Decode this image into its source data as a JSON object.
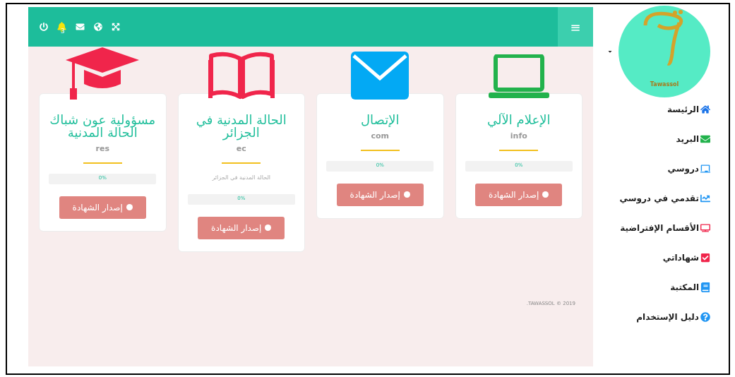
{
  "header": {
    "notifications": {
      "count": "3"
    },
    "menu_button": "≡"
  },
  "cards": [
    {
      "title": "الإعلام الآلي",
      "code": "info",
      "kind": "laptop",
      "progress": {
        "level": 0,
        "reading": "0%"
      },
      "button": "إصدار الشهادة"
    },
    {
      "title": "الإتصال",
      "code": "com",
      "kind": "envelope",
      "progress": {
        "level": 0,
        "reading": "0%"
      },
      "button": "إصدار الشهادة"
    },
    {
      "title": "الحالة المدنية في الجزائر",
      "code": "ec",
      "kind": "book",
      "description": "الحالة المدنية في الجزائر",
      "progress": {
        "level": 0,
        "reading": "0%"
      },
      "button": "إصدار الشهادة"
    },
    {
      "title": "مسؤولية عون شباك الحالة المدنية",
      "code": "res",
      "kind": "cap",
      "progress": {
        "level": 0,
        "reading": "0%"
      },
      "button": "إصدار الشهادة"
    }
  ],
  "footer": ".TAWASSOL © 2019",
  "sidebar": {
    "logo_text": "Tawassol",
    "items": [
      {
        "label": "الرئيسة",
        "kind": "home"
      },
      {
        "label": "البريد",
        "kind": "mail"
      },
      {
        "label": "دروسي",
        "kind": "board"
      },
      {
        "label": "تقدمي في دروسي",
        "kind": "trend"
      },
      {
        "label": "الأقسام الإفتراضية",
        "kind": "tv"
      },
      {
        "label": "شهاداتي",
        "kind": "check"
      },
      {
        "label": "المكتبة",
        "kind": "book"
      },
      {
        "label": "دليل الإستخدام",
        "kind": "help"
      }
    ]
  }
}
